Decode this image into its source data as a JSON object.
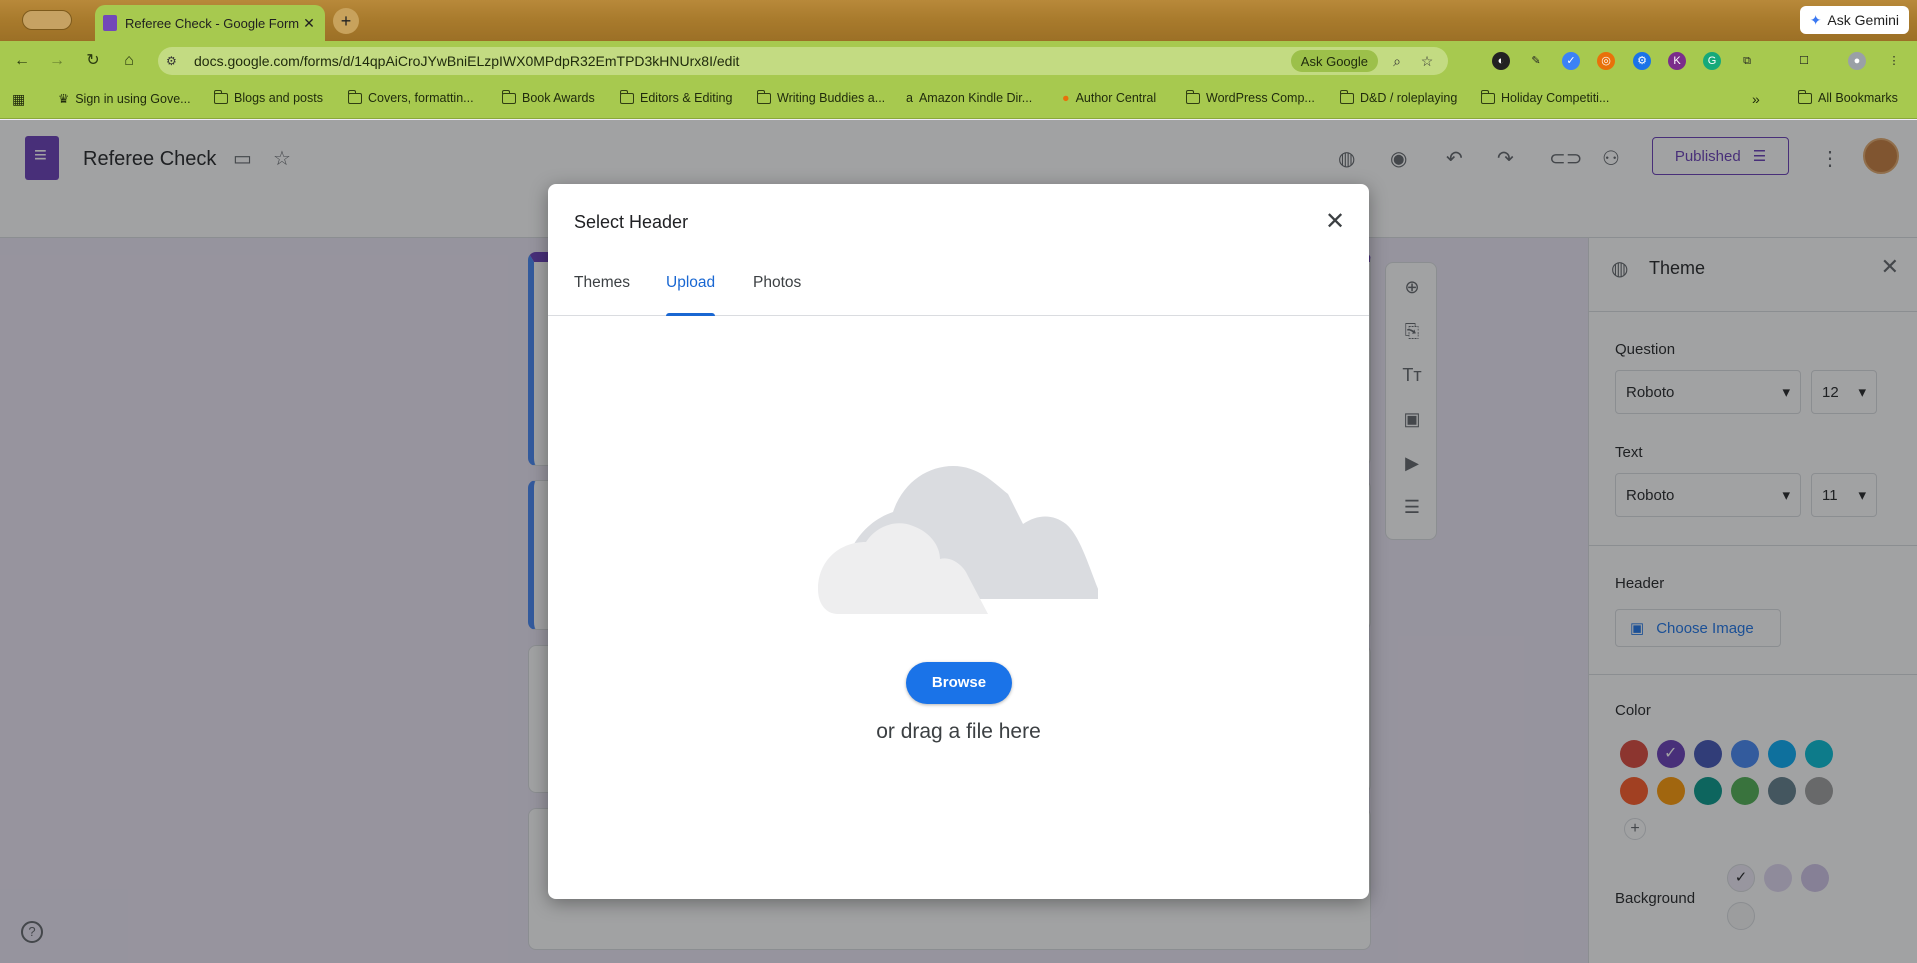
{
  "browser": {
    "tab_title": "Referee Check - Google Form",
    "ask_gemini": "Ask Gemini",
    "url": "docs.google.com/forms/d/14qpAiCroJYwBniELzpIWX0MPdpR32EmTPD3kHNUrx8I/edit",
    "ask_google": "Ask Google",
    "bookmarks": [
      "Sign in using Gove...",
      "Blogs and posts",
      "Covers, formattin...",
      "Book Awards",
      "Editors & Editing",
      "Writing Buddies a...",
      "Amazon Kindle Dir...",
      "Author Central",
      "WordPress Comp...",
      "D&D / roleplaying",
      "Holiday Competiti..."
    ],
    "more_bookmarks": "»",
    "all_bookmarks": "All Bookmarks"
  },
  "form": {
    "title": "Referee Check",
    "published_label": "Published",
    "help": "?"
  },
  "theme_panel": {
    "title": "Theme",
    "question_label": "Question",
    "question_font": "Roboto",
    "question_size": "12",
    "text_label": "Text",
    "text_font": "Roboto",
    "text_size": "11",
    "header_label": "Header",
    "choose_image": "Choose Image",
    "color_label": "Color",
    "background_label": "Background",
    "colors": [
      "#db4437",
      "#673ab7",
      "#3f51b5",
      "#4285f4",
      "#03a9f4",
      "#00bcd4",
      "#ff5722",
      "#ff9800",
      "#009688",
      "#4caf50",
      "#607d8b",
      "#9e9e9e"
    ],
    "backgrounds": [
      "#f0ebf8",
      "#e1d8f1",
      "#d1c4e9",
      "#f6f6f6"
    ]
  },
  "dialog": {
    "title": "Select Header",
    "tabs": [
      "Themes",
      "Upload",
      "Photos"
    ],
    "active_tab": "Upload",
    "browse_label": "Browse",
    "drag_text": "or drag a file here"
  }
}
